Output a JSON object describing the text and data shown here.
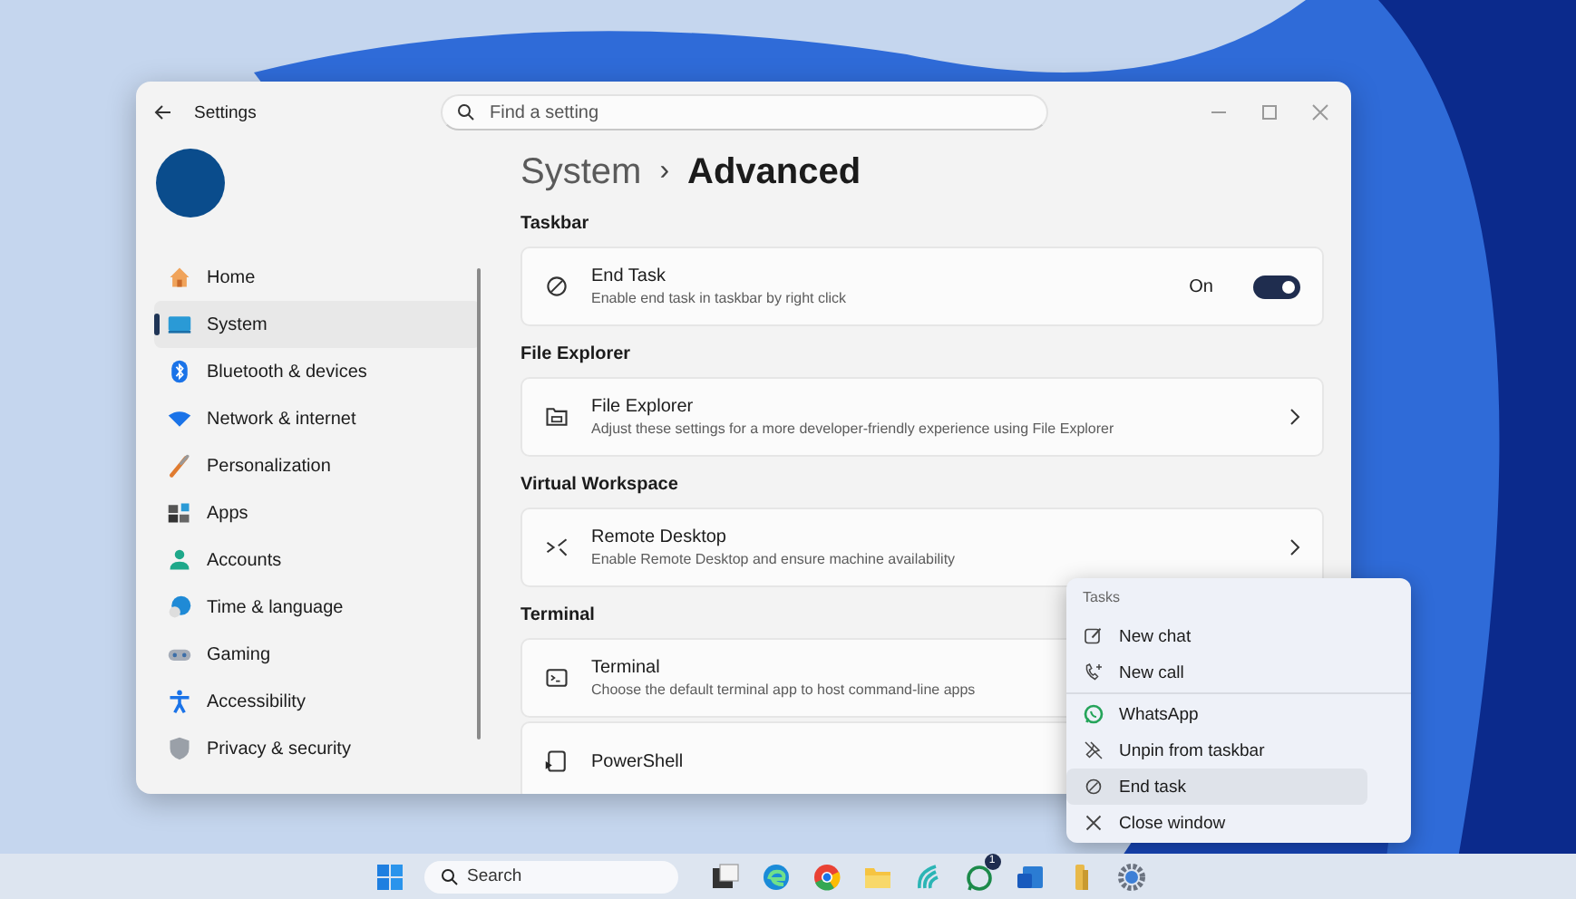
{
  "window": {
    "title": "Settings",
    "search": {
      "placeholder": "Find a setting"
    }
  },
  "nav": [
    {
      "label": "Home",
      "selected": false
    },
    {
      "label": "System",
      "selected": true
    },
    {
      "label": "Bluetooth & devices",
      "selected": false
    },
    {
      "label": "Network & internet",
      "selected": false
    },
    {
      "label": "Personalization",
      "selected": false
    },
    {
      "label": "Apps",
      "selected": false
    },
    {
      "label": "Accounts",
      "selected": false
    },
    {
      "label": "Time & language",
      "selected": false
    },
    {
      "label": "Gaming",
      "selected": false
    },
    {
      "label": "Accessibility",
      "selected": false
    },
    {
      "label": "Privacy & security",
      "selected": false
    }
  ],
  "breadcrumb": {
    "parent": "System",
    "separator": "›",
    "current": "Advanced"
  },
  "sections": [
    {
      "heading": "Taskbar",
      "cards": [
        {
          "kind": "toggle",
          "title": "End Task",
          "subtitle": "Enable end task in taskbar by right click",
          "toggle_label": "On",
          "on": true
        }
      ]
    },
    {
      "heading": "File Explorer",
      "cards": [
        {
          "kind": "link",
          "title": "File Explorer",
          "subtitle": "Adjust these settings for a more developer-friendly experience using File Explorer"
        }
      ]
    },
    {
      "heading": "Virtual Workspace",
      "cards": [
        {
          "kind": "link",
          "title": "Remote Desktop",
          "subtitle": "Enable Remote Desktop and ensure machine availability"
        }
      ]
    },
    {
      "heading": "Terminal",
      "cards": [
        {
          "kind": "link",
          "title": "Terminal",
          "subtitle": "Choose the default terminal app to host command-line apps"
        },
        {
          "kind": "link",
          "title": "PowerShell"
        }
      ]
    }
  ],
  "context_menu": {
    "heading": "Tasks",
    "groups": [
      [
        {
          "label": "New chat",
          "selected": false
        },
        {
          "label": "New call",
          "selected": false
        }
      ],
      [
        {
          "label": "WhatsApp",
          "selected": false
        },
        {
          "label": "Unpin from taskbar",
          "selected": false
        },
        {
          "label": "End task",
          "selected": true
        },
        {
          "label": "Close window",
          "selected": false
        }
      ]
    ]
  },
  "taskbar": {
    "search": {
      "placeholder": "Search"
    },
    "badge": "1"
  }
}
